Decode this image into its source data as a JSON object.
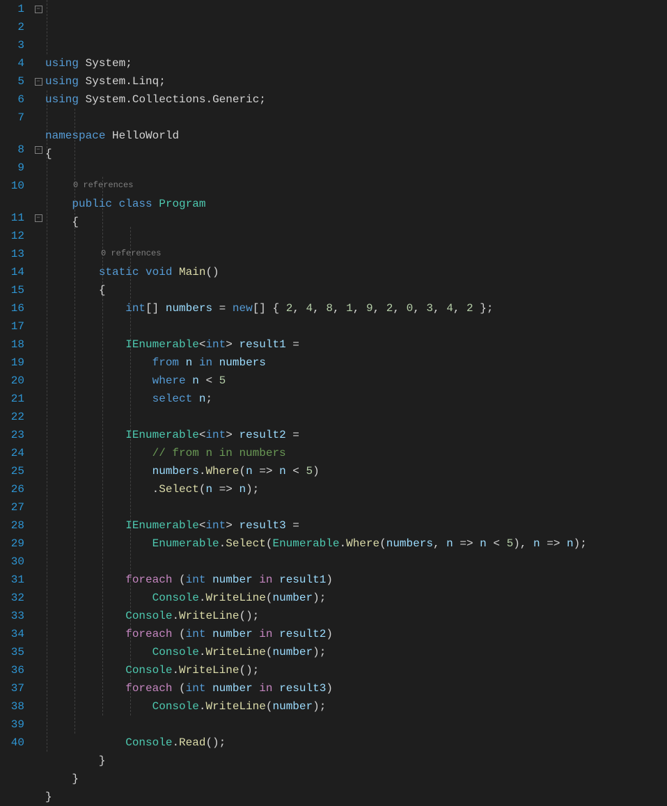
{
  "editor": {
    "total_lines": 40,
    "codelens": {
      "class": "0 references",
      "main": "0 references"
    },
    "code": [
      [
        [
          "k",
          "using"
        ],
        [
          "p",
          " "
        ],
        [
          "p",
          "System"
        ],
        [
          "p",
          ";"
        ]
      ],
      [
        [
          "k",
          "using"
        ],
        [
          "p",
          " "
        ],
        [
          "p",
          "System"
        ],
        [
          "p",
          "."
        ],
        [
          "p",
          "Linq"
        ],
        [
          "p",
          ";"
        ]
      ],
      [
        [
          "k",
          "using"
        ],
        [
          "p",
          " "
        ],
        [
          "p",
          "System"
        ],
        [
          "p",
          "."
        ],
        [
          "p",
          "Collections"
        ],
        [
          "p",
          "."
        ],
        [
          "p",
          "Generic"
        ],
        [
          "p",
          ";"
        ]
      ],
      [],
      [
        [
          "k",
          "namespace"
        ],
        [
          "p",
          " "
        ],
        [
          "p",
          "HelloWorld"
        ]
      ],
      [
        [
          "p",
          "{"
        ]
      ],
      [],
      [
        [
          "p",
          "    "
        ],
        [
          "k",
          "public"
        ],
        [
          "p",
          " "
        ],
        [
          "k",
          "class"
        ],
        [
          "p",
          " "
        ],
        [
          "t",
          "Program"
        ]
      ],
      [
        [
          "p",
          "    "
        ],
        [
          "p",
          "{"
        ]
      ],
      [],
      [
        [
          "p",
          "        "
        ],
        [
          "k",
          "static"
        ],
        [
          "p",
          " "
        ],
        [
          "k",
          "void"
        ],
        [
          "p",
          " "
        ],
        [
          "m",
          "Main"
        ],
        [
          "p",
          "()"
        ]
      ],
      [
        [
          "p",
          "        "
        ],
        [
          "p",
          "{"
        ]
      ],
      [
        [
          "p",
          "            "
        ],
        [
          "k",
          "int"
        ],
        [
          "p",
          "[] "
        ],
        [
          "v",
          "numbers"
        ],
        [
          "p",
          " = "
        ],
        [
          "k",
          "new"
        ],
        [
          "p",
          "[] { "
        ],
        [
          "n",
          "2"
        ],
        [
          "p",
          ", "
        ],
        [
          "n",
          "4"
        ],
        [
          "p",
          ", "
        ],
        [
          "n",
          "8"
        ],
        [
          "p",
          ", "
        ],
        [
          "n",
          "1"
        ],
        [
          "p",
          ", "
        ],
        [
          "n",
          "9"
        ],
        [
          "p",
          ", "
        ],
        [
          "n",
          "2"
        ],
        [
          "p",
          ", "
        ],
        [
          "n",
          "0"
        ],
        [
          "p",
          ", "
        ],
        [
          "n",
          "3"
        ],
        [
          "p",
          ", "
        ],
        [
          "n",
          "4"
        ],
        [
          "p",
          ", "
        ],
        [
          "n",
          "2"
        ],
        [
          "p",
          " };"
        ]
      ],
      [],
      [
        [
          "p",
          "            "
        ],
        [
          "t",
          "IEnumerable"
        ],
        [
          "p",
          "<"
        ],
        [
          "k",
          "int"
        ],
        [
          "p",
          "> "
        ],
        [
          "v",
          "result1"
        ],
        [
          "p",
          " ="
        ]
      ],
      [
        [
          "p",
          "                "
        ],
        [
          "k",
          "from"
        ],
        [
          "p",
          " "
        ],
        [
          "v",
          "n"
        ],
        [
          "p",
          " "
        ],
        [
          "k",
          "in"
        ],
        [
          "p",
          " "
        ],
        [
          "v",
          "numbers"
        ]
      ],
      [
        [
          "p",
          "                "
        ],
        [
          "k",
          "where"
        ],
        [
          "p",
          " "
        ],
        [
          "v",
          "n"
        ],
        [
          "p",
          " < "
        ],
        [
          "n",
          "5"
        ]
      ],
      [
        [
          "p",
          "                "
        ],
        [
          "k",
          "select"
        ],
        [
          "p",
          " "
        ],
        [
          "v",
          "n"
        ],
        [
          "p",
          ";"
        ]
      ],
      [],
      [
        [
          "p",
          "            "
        ],
        [
          "t",
          "IEnumerable"
        ],
        [
          "p",
          "<"
        ],
        [
          "k",
          "int"
        ],
        [
          "p",
          "> "
        ],
        [
          "v",
          "result2"
        ],
        [
          "p",
          " ="
        ]
      ],
      [
        [
          "p",
          "                "
        ],
        [
          "c",
          "// from n in numbers"
        ]
      ],
      [
        [
          "p",
          "                "
        ],
        [
          "v",
          "numbers"
        ],
        [
          "p",
          "."
        ],
        [
          "m",
          "Where"
        ],
        [
          "p",
          "("
        ],
        [
          "v",
          "n"
        ],
        [
          "p",
          " => "
        ],
        [
          "v",
          "n"
        ],
        [
          "p",
          " < "
        ],
        [
          "n",
          "5"
        ],
        [
          "p",
          ")"
        ]
      ],
      [
        [
          "p",
          "                ."
        ],
        [
          "m",
          "Select"
        ],
        [
          "p",
          "("
        ],
        [
          "v",
          "n"
        ],
        [
          "p",
          " => "
        ],
        [
          "v",
          "n"
        ],
        [
          "p",
          ");"
        ]
      ],
      [],
      [
        [
          "p",
          "            "
        ],
        [
          "t",
          "IEnumerable"
        ],
        [
          "p",
          "<"
        ],
        [
          "k",
          "int"
        ],
        [
          "p",
          "> "
        ],
        [
          "v",
          "result3"
        ],
        [
          "p",
          " ="
        ]
      ],
      [
        [
          "p",
          "                "
        ],
        [
          "t",
          "Enumerable"
        ],
        [
          "p",
          "."
        ],
        [
          "m",
          "Select"
        ],
        [
          "p",
          "("
        ],
        [
          "t",
          "Enumerable"
        ],
        [
          "p",
          "."
        ],
        [
          "m",
          "Where"
        ],
        [
          "p",
          "("
        ],
        [
          "v",
          "numbers"
        ],
        [
          "p",
          ", "
        ],
        [
          "v",
          "n"
        ],
        [
          "p",
          " => "
        ],
        [
          "v",
          "n"
        ],
        [
          "p",
          " < "
        ],
        [
          "n",
          "5"
        ],
        [
          "p",
          "), "
        ],
        [
          "v",
          "n"
        ],
        [
          "p",
          " => "
        ],
        [
          "v",
          "n"
        ],
        [
          "p",
          ");"
        ]
      ],
      [],
      [
        [
          "p",
          "            "
        ],
        [
          "s",
          "foreach"
        ],
        [
          "p",
          " ("
        ],
        [
          "k",
          "int"
        ],
        [
          "p",
          " "
        ],
        [
          "v",
          "number"
        ],
        [
          "p",
          " "
        ],
        [
          "s",
          "in"
        ],
        [
          "p",
          " "
        ],
        [
          "v",
          "result1"
        ],
        [
          "p",
          ")"
        ]
      ],
      [
        [
          "p",
          "                "
        ],
        [
          "t",
          "Console"
        ],
        [
          "p",
          "."
        ],
        [
          "m",
          "WriteLine"
        ],
        [
          "p",
          "("
        ],
        [
          "v",
          "number"
        ],
        [
          "p",
          ");"
        ]
      ],
      [
        [
          "p",
          "            "
        ],
        [
          "t",
          "Console"
        ],
        [
          "p",
          "."
        ],
        [
          "m",
          "WriteLine"
        ],
        [
          "p",
          "();"
        ]
      ],
      [
        [
          "p",
          "            "
        ],
        [
          "s",
          "foreach"
        ],
        [
          "p",
          " ("
        ],
        [
          "k",
          "int"
        ],
        [
          "p",
          " "
        ],
        [
          "v",
          "number"
        ],
        [
          "p",
          " "
        ],
        [
          "s",
          "in"
        ],
        [
          "p",
          " "
        ],
        [
          "v",
          "result2"
        ],
        [
          "p",
          ")"
        ]
      ],
      [
        [
          "p",
          "                "
        ],
        [
          "t",
          "Console"
        ],
        [
          "p",
          "."
        ],
        [
          "m",
          "WriteLine"
        ],
        [
          "p",
          "("
        ],
        [
          "v",
          "number"
        ],
        [
          "p",
          ");"
        ]
      ],
      [
        [
          "p",
          "            "
        ],
        [
          "t",
          "Console"
        ],
        [
          "p",
          "."
        ],
        [
          "m",
          "WriteLine"
        ],
        [
          "p",
          "();"
        ]
      ],
      [
        [
          "p",
          "            "
        ],
        [
          "s",
          "foreach"
        ],
        [
          "p",
          " ("
        ],
        [
          "k",
          "int"
        ],
        [
          "p",
          " "
        ],
        [
          "v",
          "number"
        ],
        [
          "p",
          " "
        ],
        [
          "s",
          "in"
        ],
        [
          "p",
          " "
        ],
        [
          "v",
          "result3"
        ],
        [
          "p",
          ")"
        ]
      ],
      [
        [
          "p",
          "                "
        ],
        [
          "t",
          "Console"
        ],
        [
          "p",
          "."
        ],
        [
          "m",
          "WriteLine"
        ],
        [
          "p",
          "("
        ],
        [
          "v",
          "number"
        ],
        [
          "p",
          ");"
        ]
      ],
      [],
      [
        [
          "p",
          "            "
        ],
        [
          "t",
          "Console"
        ],
        [
          "p",
          "."
        ],
        [
          "m",
          "Read"
        ],
        [
          "p",
          "();"
        ]
      ],
      [
        [
          "p",
          "        "
        ],
        [
          "p",
          "}"
        ]
      ],
      [
        [
          "p",
          "    "
        ],
        [
          "p",
          "}"
        ]
      ],
      [
        [
          "p",
          "}"
        ]
      ]
    ],
    "fold_markers": {
      "1": "⊟",
      "5": "⊟",
      "8": "⊟",
      "11": "⊟"
    }
  }
}
